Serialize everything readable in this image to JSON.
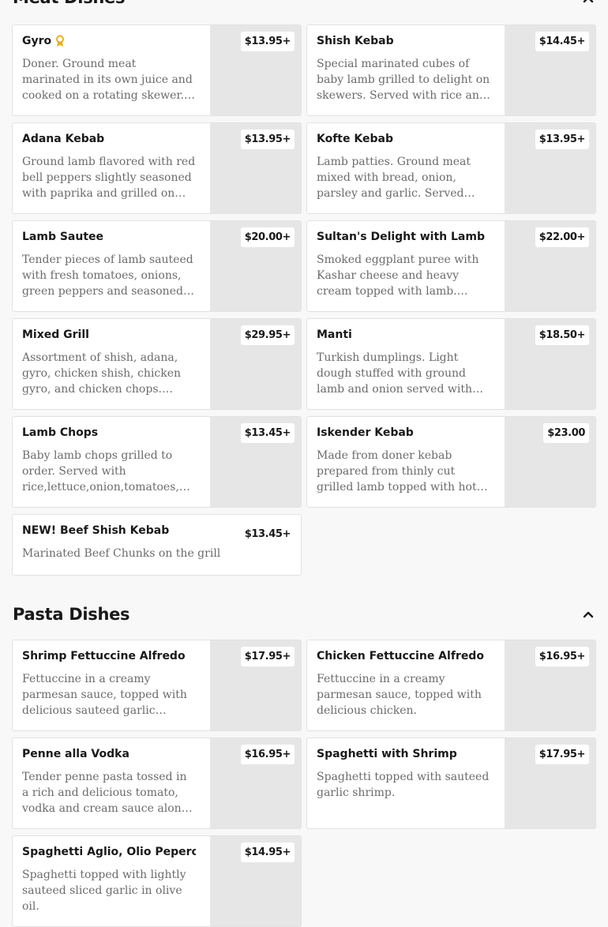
{
  "sections": [
    {
      "title": "Meat Dishes",
      "toggle_icon": "close-icon",
      "items": [
        {
          "name": "Gyro",
          "desc": "Doner. Ground meat marinated in its own juice and cooked on a rotating skewer. Shaved in thin slices. Served with rice and salad.",
          "price": "$13.95+",
          "badge": "award-icon"
        },
        {
          "name": "Shish Kebab",
          "desc": "Special marinated cubes of baby lamb grilled to delight on skewers. Served with rice and salad.",
          "price": "$14.45+"
        },
        {
          "name": "Adana Kebab",
          "desc": "Ground lamb flavored with red bell peppers slightly seasoned with paprika and grilled on skewers.",
          "price": "$13.95+"
        },
        {
          "name": "Kofte Kebab",
          "desc": "Lamb patties. Ground meat mixed with bread, onion, parsley and garlic. Served with rice and salad.",
          "price": "$13.95+"
        },
        {
          "name": "Lamb Sautee",
          "desc": "Tender pieces of lamb sauteed with fresh tomatoes, onions, green peppers and seasoned with spices.",
          "price": "$20.00+"
        },
        {
          "name": "Sultan's Delight with Lamb",
          "desc": "Smoked eggplant puree with Kashar cheese and heavy cream topped with lamb. Served with rice.",
          "price": "$22.00+"
        },
        {
          "name": "Mixed Grill",
          "desc": "Assortment of shish, adana, gyro, chicken shish, chicken gyro, and chicken chops. Served with rice and salad.",
          "price": "$29.95+"
        },
        {
          "name": "Manti",
          "desc": "Turkish dumplings. Light dough stuffed with ground lamb and onion served with seasonings and yogurt.",
          "price": "$18.50+"
        },
        {
          "name": "Lamb Chops",
          "desc": "Baby lamb chops grilled to order. Served with rice,lettuce,onion,tomatoes, and peppers.",
          "price": "$13.45+"
        },
        {
          "name": "Iskender Kebab",
          "desc": "Made from doner kebab prepared from thinly cut grilled lamb topped with hot tomato sauce and yogurt.",
          "price": "$23.00"
        },
        {
          "name": "NEW! Beef Shish Kebab",
          "desc": "Marinated Beef Chunks on the grill",
          "price": "$13.45+",
          "short": true
        }
      ]
    },
    {
      "title": "Pasta Dishes",
      "toggle_icon": "chevron-up-icon",
      "items": [
        {
          "name": "Shrimp Fettuccine Alfredo",
          "desc": "Fettuccine in a creamy parmesan sauce, topped with delicious sauteed garlic shrimp.",
          "price": "$17.95+"
        },
        {
          "name": "Chicken Fettuccine Alfredo",
          "desc": "Fettuccine in a creamy parmesan sauce, topped with delicious chicken.",
          "price": "$16.95+"
        },
        {
          "name": "Penne alla Vodka",
          "desc": "Tender penne pasta tossed in a rich and delicious tomato, vodka and cream sauce along with parmesan cheese.",
          "price": "$16.95+"
        },
        {
          "name": "Spaghetti with Shrimp",
          "desc": "Spaghetti topped with sauteed garlic shrimp.",
          "price": "$17.95+"
        },
        {
          "name": "Spaghetti Aglio, Olio Peperoncino",
          "desc": "Spaghetti topped with lightly sauteed sliced garlic in olive oil.",
          "price": "$14.95+"
        }
      ]
    }
  ]
}
